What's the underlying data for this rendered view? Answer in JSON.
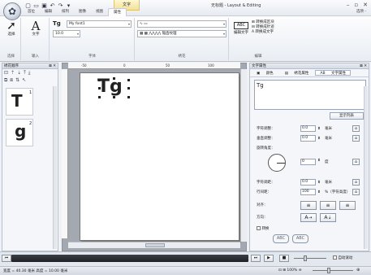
{
  "window": {
    "title": "无标题 - Layout & Editing",
    "context_tab": "文字",
    "help": "选项 - ",
    "controls": [
      "–",
      "▫",
      "✕"
    ]
  },
  "tabs": [
    {
      "label": "首位"
    },
    {
      "label": "编辑"
    },
    {
      "label": "排列"
    },
    {
      "label": "图像"
    },
    {
      "label": "视图"
    },
    {
      "label": "属性",
      "active": true
    }
  ],
  "ribbon": {
    "select_label": "选择",
    "text_label": "文字",
    "font_name": "My font1",
    "font_size": "10.0",
    "wave_option": "锯齿纹理",
    "edit_text_label": "编辑文字",
    "convert1": "转换成区块",
    "convert2": "转换成针迹",
    "convert3": "转换成文字",
    "groups": {
      "select": "选择",
      "insert": "输入",
      "font": "字体",
      "stitch": "绣花",
      "edit": "编辑"
    }
  },
  "left_panel": {
    "title": "绣花顺序",
    "items": [
      {
        "glyph": "T",
        "order": "1"
      },
      {
        "glyph": "g",
        "order": "2"
      }
    ]
  },
  "canvas": {
    "text": "Tg",
    "ruler_marks": [
      "-50",
      "0",
      "50",
      "100"
    ]
  },
  "right_panel": {
    "title": "文字属性",
    "tabs": [
      "颜色",
      "绣花属性",
      "文字属性"
    ],
    "text_value": "Tg",
    "show_list": "显示列表",
    "char_spacing_label": "字符调整：",
    "char_spacing_value": "0.0",
    "vertical_label": "垂直调整：",
    "vertical_value": "0.0",
    "rotation_label": "旋转角度：",
    "rotation_value": "0",
    "width_label": "字符调距：",
    "width_value": "0.0",
    "line_spacing_label": "行间距：",
    "line_spacing_value": "100",
    "line_spacing_unit": "%（字符高度）",
    "unit_mm": "毫米",
    "unit_deg": "度",
    "align_label": "对齐：",
    "direction_label": "方向：",
    "convert_label": "转换"
  },
  "playback": {
    "auto_scroll": "自动滚动"
  },
  "statusbar": {
    "text": "宽度 = 40.30 毫米  高度 = 10.00 毫米",
    "zoom": "100%"
  }
}
